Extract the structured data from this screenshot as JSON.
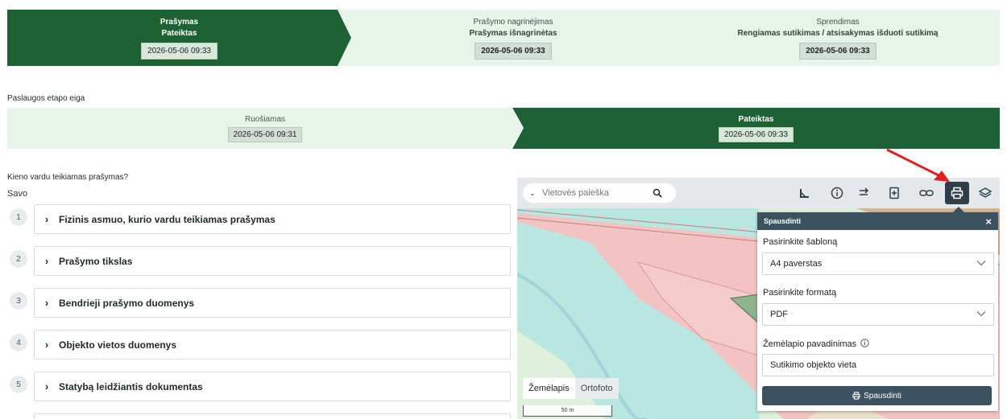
{
  "stepper": {
    "steps": [
      {
        "title": "Prašymas",
        "status": "Pateiktas",
        "date": "2026-05-06 09:33"
      },
      {
        "title": "Prašymo nagrinėjimas",
        "status": "Prašymas išnagrinėtas",
        "date": "2026-05-06 09:33"
      },
      {
        "title": "Sprendimas",
        "status": "Rengiamas sutikimas / atsisakymas išduoti sutikimą",
        "date": "2026-05-06 09:33"
      }
    ]
  },
  "service_stage": {
    "label": "Paslaugos etapo eiga",
    "steps": [
      {
        "title": "Ruošiamas",
        "date": "2026-05-06 09:31"
      },
      {
        "title": "Pateiktas",
        "date": "2026-05-06 09:33"
      }
    ]
  },
  "form": {
    "question": "Kieno vardu teikiamas prašymas?",
    "answer": "Savo",
    "sections": [
      {
        "num": "1",
        "label": "Fizinis asmuo, kurio vardu teikiamas prašymas"
      },
      {
        "num": "2",
        "label": "Prašymo tikslas"
      },
      {
        "num": "3",
        "label": "Bendrieji prašymo duomenys"
      },
      {
        "num": "4",
        "label": "Objekto vietos duomenys"
      },
      {
        "num": "5",
        "label": "Statybą leidžiantis dokumentas"
      }
    ]
  },
  "map": {
    "search_placeholder": "Vietovės paieška",
    "tools": [
      "measure-icon",
      "info-icon",
      "route-icon",
      "add-document-icon",
      "link-icon",
      "printer-icon",
      "layers-icon"
    ],
    "layers": {
      "map": "Žemėlapis",
      "ortho": "Ortofoto"
    },
    "scale": "50 m",
    "print_popup": {
      "title": "Spausdinti",
      "template_label": "Pasirinkite šabloną",
      "template_value": "A4 paverstas",
      "format_label": "Pasirinkite formatą",
      "format_value": "PDF",
      "name_label": "Žemėlapio pavadinimas",
      "name_value": "Sutikimo objekto vieta",
      "button": "Spausdinti"
    }
  },
  "colors": {
    "primary_green": "#1e6234",
    "light_green": "#e7f4ea",
    "slate": "#3d5261",
    "annotation_arrow": "#e02020"
  }
}
